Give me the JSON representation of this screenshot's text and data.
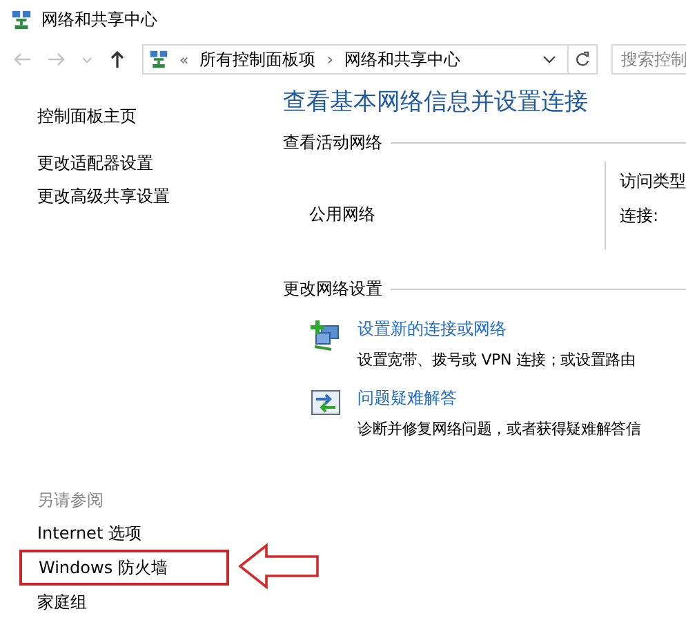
{
  "window": {
    "title": "网络和共享中心"
  },
  "address_bar": {
    "nav": [
      {
        "kind": "back",
        "disabled": true
      },
      {
        "kind": "forward",
        "disabled": true
      },
      {
        "kind": "recent",
        "disabled": true
      },
      {
        "kind": "up",
        "disabled": false
      }
    ],
    "overflow": "«",
    "path": [
      "所有控制面板项",
      "网络和共享中心"
    ],
    "separator": "›",
    "search_placeholder": "搜索控制"
  },
  "sidebar": {
    "links": [
      "控制面板主页",
      "更改适配器设置",
      "更改高级共享设置"
    ],
    "see_also_title": "另请参阅",
    "see_also": [
      {
        "label": "Internet 选项",
        "highlighted": false
      },
      {
        "label": "Windows 防火墙",
        "highlighted": true
      },
      {
        "label": "家庭组",
        "highlighted": false
      }
    ]
  },
  "main": {
    "heading": "查看基本网络信息并设置连接",
    "active_networks": {
      "title": "查看活动网络",
      "network_name": "公用网络",
      "access_type_label": "访问类型",
      "connections_label": "连接:"
    },
    "change_settings": {
      "title": "更改网络设置",
      "items": [
        {
          "kind": "new-connection",
          "link": "设置新的连接或网络",
          "description": "设置宽带、拨号或 VPN 连接；或设置路由"
        },
        {
          "kind": "troubleshoot",
          "link": "问题疑难解答",
          "description": "诊断并修复网络问题，或者获得疑难解答信"
        }
      ]
    }
  }
}
